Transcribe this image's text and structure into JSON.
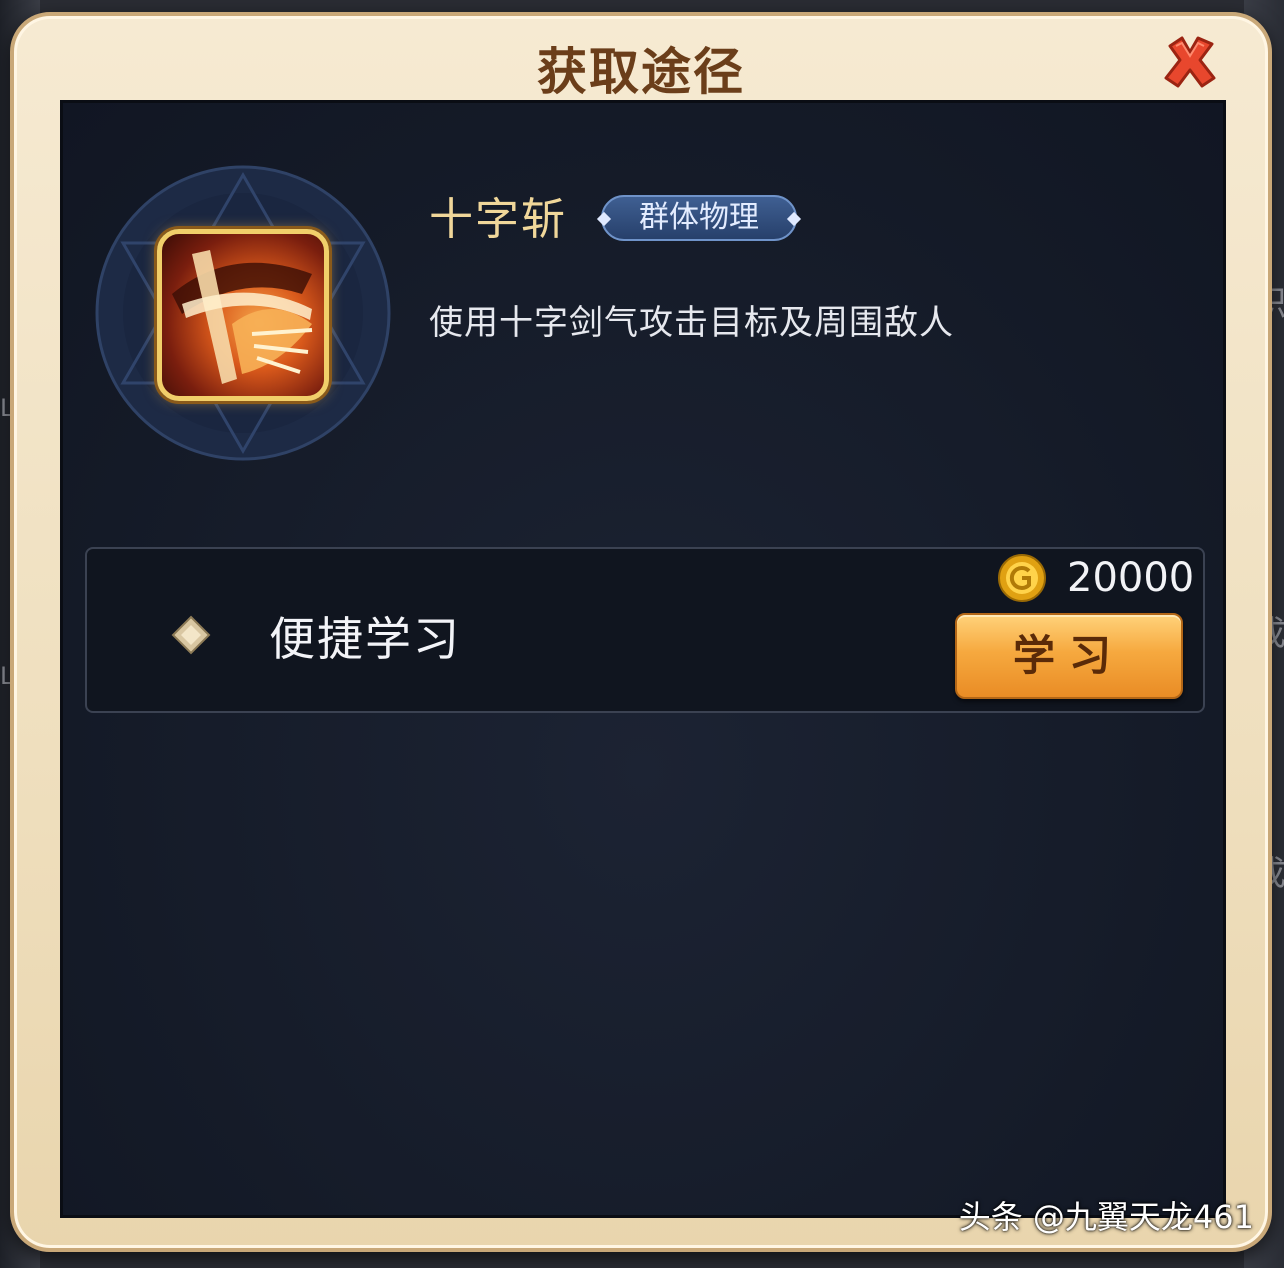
{
  "dialog": {
    "title": "获取途径",
    "close_icon": "close-icon"
  },
  "skill": {
    "name": "十字斩",
    "tag": "群体物理",
    "description": "使用十字剑气攻击目标及周围敌人",
    "icon": "cross-slash-skill-icon"
  },
  "acquisition": {
    "label": "便捷学习",
    "cost": "20000",
    "currency_icon": "gold-coin-icon",
    "button_label": "学习"
  },
  "background": {
    "left_labels": [
      "Lv",
      "Lv"
    ],
    "right_labels": [
      "职",
      "成",
      "成"
    ]
  },
  "watermark": "头条 @九翼天龙461",
  "colors": {
    "frame": "#efdfbe",
    "panel": "#141a27",
    "title": "#6b3e1a",
    "close": "#e0452c",
    "button": "#f6a93f",
    "skill_name": "#f0d79a"
  }
}
